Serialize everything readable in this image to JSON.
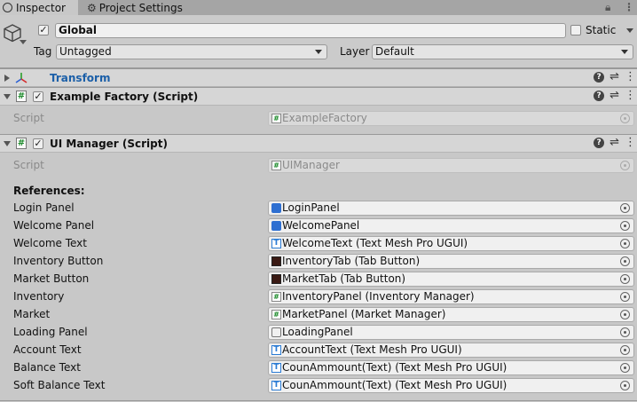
{
  "tabs": [
    {
      "label": "Inspector",
      "icon": "info-icon"
    },
    {
      "label": "Project Settings",
      "icon": "gear-icon"
    }
  ],
  "object": {
    "name": "Global",
    "active": true,
    "static_label": "Static",
    "tag_label": "Tag",
    "tag_value": "Untagged",
    "layer_label": "Layer",
    "layer_value": "Default"
  },
  "components": [
    {
      "title": "Transform",
      "expanded": false
    },
    {
      "title": "Example Factory (Script)",
      "enabled": true,
      "expanded": true,
      "script_label": "Script",
      "script_value": "ExampleFactory"
    },
    {
      "title": "UI Manager (Script)",
      "enabled": true,
      "expanded": true,
      "script_label": "Script",
      "script_value": "UIManager"
    }
  ],
  "references": {
    "heading": "References:",
    "rows": [
      {
        "label": "Login Panel",
        "value": "LoginPanel",
        "icon": "prefab-icon"
      },
      {
        "label": "Welcome Panel",
        "value": "WelcomePanel",
        "icon": "prefab-icon"
      },
      {
        "label": "Welcome Text",
        "value": "WelcomeText (Text Mesh Pro UGUI)",
        "icon": "text-mesh-pro-icon"
      },
      {
        "label": "Inventory Button",
        "value": "InventoryTab (Tab Button)",
        "icon": "image-icon"
      },
      {
        "label": "Market Button",
        "value": "MarketTab (Tab Button)",
        "icon": "image-icon"
      },
      {
        "label": "Inventory",
        "value": "InventoryPanel (Inventory Manager)",
        "icon": "script-icon"
      },
      {
        "label": "Market",
        "value": "MarketPanel (Market Manager)",
        "icon": "script-icon"
      },
      {
        "label": "Loading Panel",
        "value": "LoadingPanel",
        "icon": "gameobject-icon"
      },
      {
        "label": "Account Text",
        "value": "AccountText (Text Mesh Pro UGUI)",
        "icon": "text-mesh-pro-icon"
      },
      {
        "label": "Balance Text",
        "value": "CounAmmount(Text) (Text Mesh Pro UGUI)",
        "icon": "text-mesh-pro-icon"
      },
      {
        "label": "Soft Balance Text",
        "value": "CounAmmount(Text) (Text Mesh Pro UGUI)",
        "icon": "text-mesh-pro-icon"
      }
    ]
  },
  "colors": {
    "link": "#1b5fa8",
    "script_green": "#1c8a2a",
    "tmp_blue": "#2a7bd4"
  }
}
